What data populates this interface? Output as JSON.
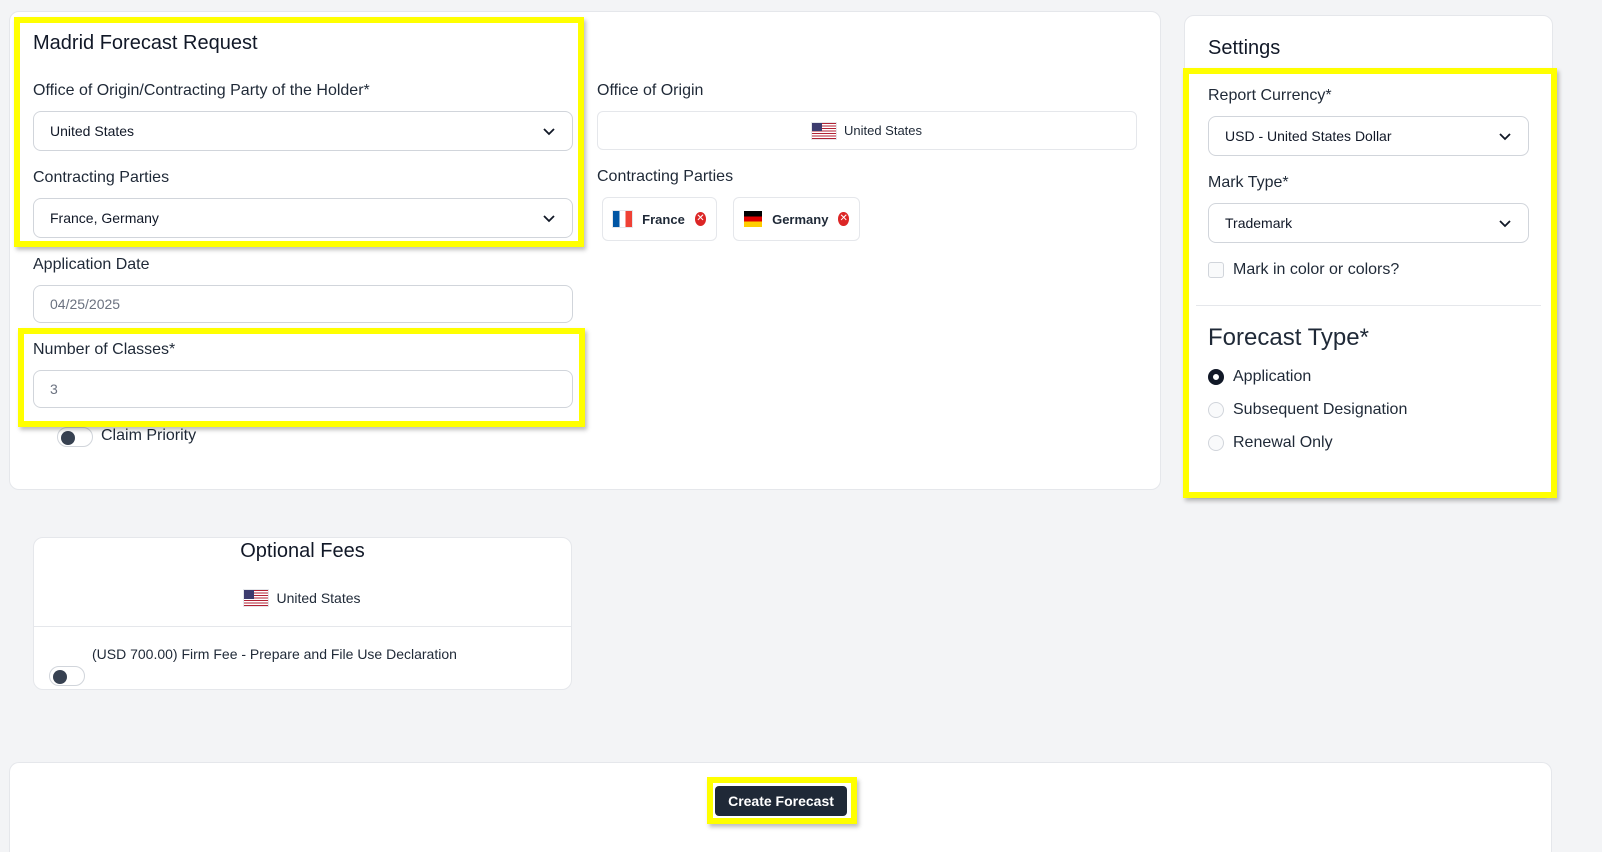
{
  "form": {
    "title": "Madrid Forecast Request",
    "office_label": "Office of Origin/Contracting Party of the Holder*",
    "office_value": "United States",
    "parties_label": "Contracting Parties",
    "parties_value": "France, Germany",
    "date_label": "Application Date",
    "date_value": "04/25/2025",
    "classes_label": "Number of Classes*",
    "classes_value": "3",
    "claim_priority_label": "Claim Priority"
  },
  "summary": {
    "office_label": "Office of Origin",
    "office_value": "United States",
    "parties_label": "Contracting Parties",
    "parties": [
      {
        "name": "France",
        "flag": "flag-fr-icon"
      },
      {
        "name": "Germany",
        "flag": "flag-de-icon"
      }
    ]
  },
  "settings": {
    "title": "Settings",
    "currency_label": "Report Currency*",
    "currency_value": "USD - United States Dollar",
    "mark_type_label": "Mark Type*",
    "mark_type_value": "Trademark",
    "color_checkbox_label": "Mark in color or colors?",
    "forecast_type_label": "Forecast Type*",
    "forecast_options": [
      "Application",
      "Subsequent Designation",
      "Renewal Only"
    ],
    "forecast_selected": "Application"
  },
  "optional_fees": {
    "title": "Optional Fees",
    "country": "United States",
    "fees": [
      {
        "label": "(USD 700.00) Firm Fee - Prepare and File Use Declaration",
        "enabled": false
      }
    ]
  },
  "actions": {
    "create_label": "Create Forecast"
  },
  "colors": {
    "highlight": "#ffff00",
    "primary_dark": "#1f2937",
    "remove": "#dc2626"
  }
}
